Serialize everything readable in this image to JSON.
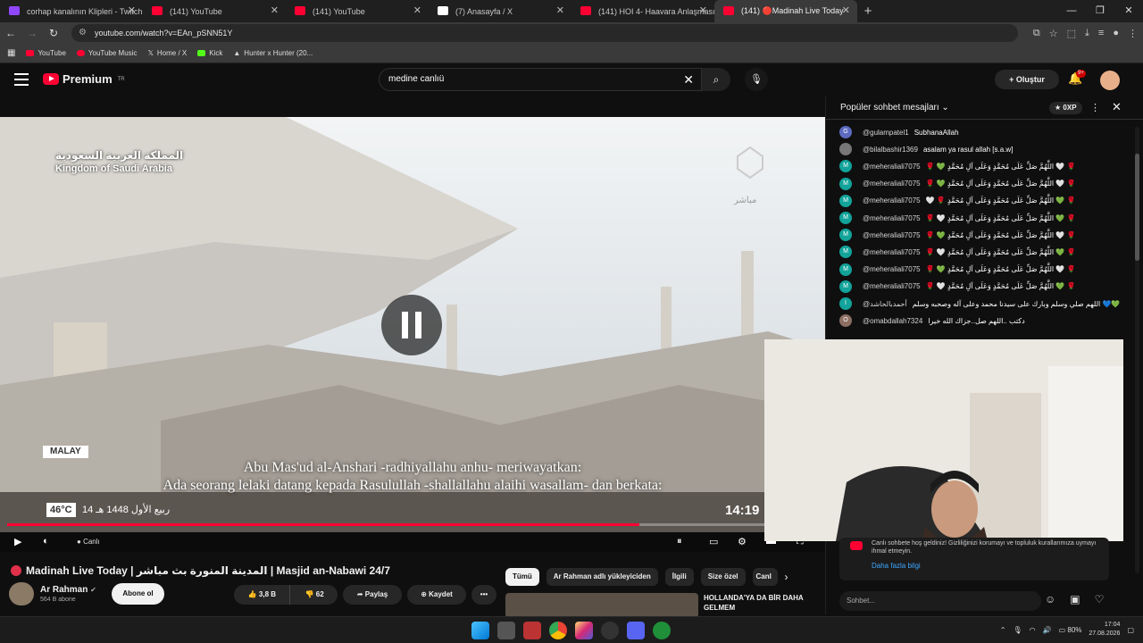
{
  "browser": {
    "tabs": [
      {
        "title": "corhap kanalının Klipleri - Twitch",
        "color": "#9146ff",
        "active": false
      },
      {
        "title": "(141) YouTube",
        "color": "#ff0033",
        "active": false
      },
      {
        "title": "(141) YouTube",
        "color": "#ff0033",
        "active": false
      },
      {
        "title": "(7) Anasayfa / X",
        "color": "#ffffff",
        "active": false
      },
      {
        "title": "(141) HOI 4- Haavara Anlaşması",
        "color": "#ff0033",
        "active": false
      },
      {
        "title": "(141) 🔴Madinah Live Today",
        "color": "#ff0033",
        "active": true
      }
    ],
    "url": "youtube.com/watch?v=EAn_pSNN51Y",
    "bookmarks": [
      "YouTube",
      "YouTube Music",
      "Home / X",
      "Kick",
      "Hunter x Hunter (20..."
    ]
  },
  "youtube": {
    "logo_text": "Premium",
    "logo_region": "TR",
    "search_value": "medine canlıü",
    "create_label": "Oluştur",
    "notif_count": "9+",
    "accent": "#ff0033"
  },
  "video": {
    "overlay_top_ar": "المملكة العربية السعودية",
    "overlay_top_en": "Kingdom of Saudi Arabia",
    "overlay_logo_ar": "مباشر",
    "lang_tag": "MALAY",
    "subtitle_line1": "Abu Mas'ud al-Anshari -radhiyallahu anhu- meriwayatkan:",
    "subtitle_line2": "Ada seorang lelaki datang kepada Rasulullah -shallallahu alaihi wasallam- dan berkata:",
    "temperature": "46°C",
    "hijri_date": "14 ربيع الأول 1448 هـ",
    "clock": "14:19",
    "live_label": "Canlı",
    "progress": 0.78
  },
  "info": {
    "title": "Madinah Live Today | المدينة المنورة بث مباشر | Masjid an-Nabawi 24/7",
    "channel": "Ar Rahman",
    "subscribers": "564 B abone",
    "subscribe_label": "Abone ol",
    "likes": "3,8 B",
    "dislikes": "62",
    "share_label": "Paylaş",
    "save_label": "Kaydet",
    "more_label": "•••"
  },
  "chips": [
    "Tümü",
    "Ar Rahman adlı yükleyiciden",
    "İlgili",
    "Size özel",
    "Canl"
  ],
  "recommendation": {
    "title": "HOLLANDA'YA DA BİR DAHA GELMEM"
  },
  "chat": {
    "title": "Popüler sohbet mesajları",
    "xp": "0XP",
    "messages": [
      {
        "initial": "G",
        "color": "#5c6bc0",
        "author": "@gulampatel1",
        "text": "SubhanaAllah"
      },
      {
        "initial": "",
        "color": "#777777",
        "author": "@bilalbashir1369",
        "text": "asalam ya rasul allah [s.a.w]"
      },
      {
        "initial": "M",
        "color": "#12a39a",
        "author": "@meheraliali7075",
        "text": "🌹 💚 اللَّهُمَّ صَلِّ عَلَى مُحَمَّدٍ وَعَلَى آلِ مُحَمَّدٍ 🤍 🌹"
      },
      {
        "initial": "M",
        "color": "#12a39a",
        "author": "@meheraliali7075",
        "text": "🌹 💚 اللَّهُمَّ صَلِّ عَلَى مُحَمَّدٍ وَعَلَى آلِ مُحَمَّدٍ 🤍 🌹"
      },
      {
        "initial": "M",
        "color": "#12a39a",
        "author": "@meheraliali7075",
        "text": "🤍 🌹 اللَّهُمَّ صَلِّ عَلَى مُحَمَّدٍ وَعَلَى آلِ مُحَمَّدٍ 💚 🌹"
      },
      {
        "initial": "M",
        "color": "#12a39a",
        "author": "@meheraliali7075",
        "text": "🌹 🤍 اللَّهُمَّ صَلِّ عَلَى مُحَمَّدٍ وَعَلَى آلِ مُحَمَّدٍ 💚 🌹"
      },
      {
        "initial": "M",
        "color": "#12a39a",
        "author": "@meheraliali7075",
        "text": "🌹 💚 اللَّهُمَّ صَلِّ عَلَى مُحَمَّدٍ وَعَلَى آلِ مُحَمَّدٍ 🤍 🌹"
      },
      {
        "initial": "M",
        "color": "#12a39a",
        "author": "@meheraliali7075",
        "text": "🌹 🤍 اللَّهُمَّ صَلِّ عَلَى مُحَمَّدٍ وَعَلَى آلِ مُحَمَّدٍ 💚 🌹"
      },
      {
        "initial": "M",
        "color": "#12a39a",
        "author": "@meheraliali7075",
        "text": "🌹 💚 اللَّهُمَّ صَلِّ عَلَى مُحَمَّدٍ وَعَلَى آلِ مُحَمَّدٍ 🤍 🌹"
      },
      {
        "initial": "M",
        "color": "#12a39a",
        "author": "@meheraliali7075",
        "text": "🌹 🤍 اللَّهُمَّ صَلِّ عَلَى مُحَمَّدٍ وَعَلَى آلِ مُحَمَّدٍ 💚 🌹"
      },
      {
        "initial": "I",
        "color": "#12a39a",
        "author": "@أحمدبالحاشد",
        "text": "اللهم صلي وسلم وبارك على سيدنا محمد وعلى آله وصحبه وسلم 💙💚"
      },
      {
        "initial": "O",
        "color": "#8d6e63",
        "author": "@omabdallah7324",
        "text": "دكتب ..اللهم صل..جزاك الله خيرا"
      }
    ],
    "notice_text": "Canlı sohbete hoş geldiniz! Gizliliğinizi korumayı ve topluluk kurallarımıza uymayı ihmal etmeyin.",
    "notice_link": "Daha fazla bilgi",
    "input_placeholder": "Sohbet..."
  },
  "taskbar": {
    "battery": "80%",
    "time": "17:04",
    "date": "27.08.2026"
  }
}
